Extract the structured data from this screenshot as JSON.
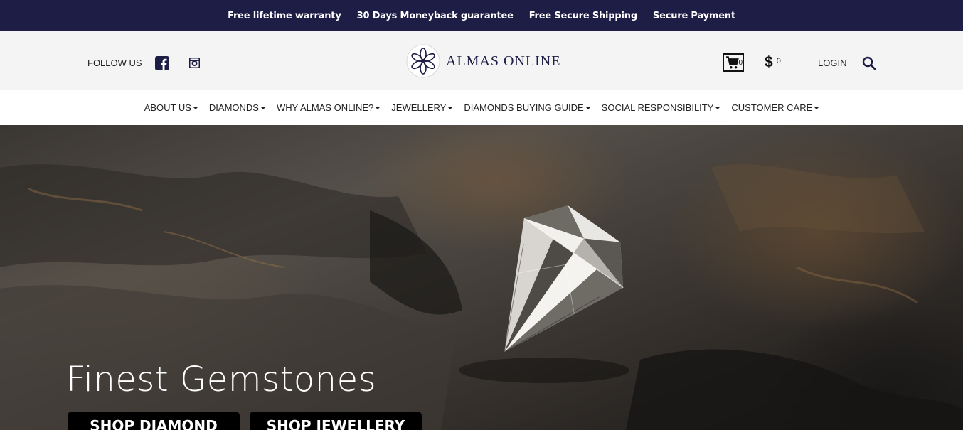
{
  "topbar": {
    "items": [
      "Free lifetime warranty",
      "30 Days Moneyback guarantee",
      "Free Secure Shipping",
      "Secure Payment"
    ]
  },
  "header": {
    "follow_label": "FOLLOW US",
    "social_icons": [
      "facebook-icon",
      "instagram-icon"
    ],
    "logo_text": "ALMAS ONLINE",
    "cart_count": "0",
    "currency_symbol": "$",
    "currency_amount": "0",
    "login_label": "LOGIN"
  },
  "nav": {
    "items": [
      "ABOUT US",
      "DIAMONDS",
      "WHY ALMAS ONLINE?",
      "JEWELLERY",
      "DIAMONDS BUYING GUIDE",
      "SOCIAL RESPONSIBILITY",
      "CUSTOMER CARE"
    ]
  },
  "hero": {
    "title": "Finest Gemstones",
    "buttons": [
      "SHOP DIAMOND",
      "SHOP JEWELLERY"
    ]
  },
  "colors": {
    "topbar_bg": "#1e1d45",
    "header_bg": "#f4f4f4",
    "button_bg": "#000000"
  }
}
